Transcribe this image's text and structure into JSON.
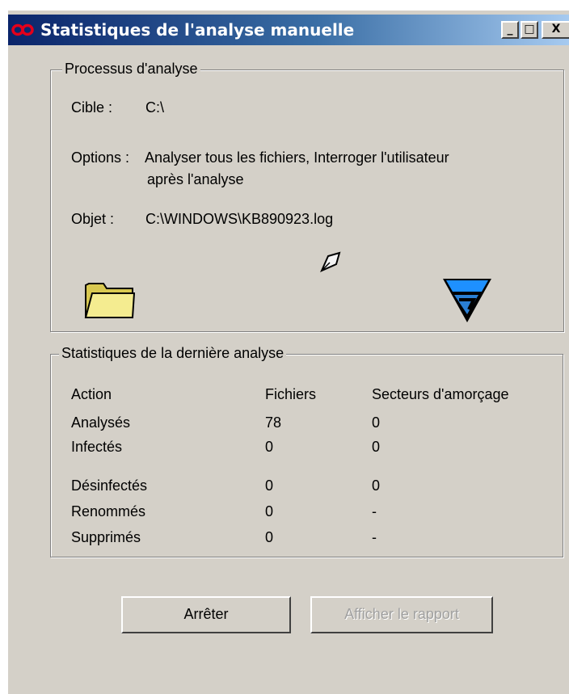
{
  "window": {
    "title": "Statistiques de l'analyse manuelle",
    "minimize_glyph": "_",
    "maximize_glyph": "□",
    "close_glyph": "X"
  },
  "process": {
    "legend": "Processus d'analyse",
    "target_label": "Cible :",
    "target_value": "C:\\",
    "options_label": "Options :",
    "options_line1": "Analyser tous les fichiers, Interroger l'utilisateur",
    "options_line2": "après l'analyse",
    "object_label": "Objet :",
    "object_value": "C:\\WINDOWS\\KB890923.log"
  },
  "stats": {
    "legend": "Statistiques de la dernière analyse",
    "headers": [
      "Action",
      "Fichiers",
      "Secteurs d'amorçage"
    ],
    "rows": [
      [
        "Analysés",
        "78",
        "0"
      ],
      [
        "Infectés",
        "0",
        "0"
      ],
      [
        "Désinfectés",
        "0",
        "0"
      ],
      [
        "Renommés",
        "0",
        "-"
      ],
      [
        "Supprimés",
        "0",
        "-"
      ]
    ]
  },
  "buttons": {
    "stop": "Arrêter",
    "report": "Afficher le rapport"
  },
  "icons": {
    "app": "avira-infinity-icon",
    "folder": "folder-icon",
    "scan": "cursor-icon",
    "vendor": "vendor-logo-icon"
  },
  "colors": {
    "title_bar": "#0a246a",
    "face": "#d4d0c8",
    "app_icon": "#e3001b",
    "folder": "#f0e68c",
    "vendor": "#1e90ff"
  }
}
